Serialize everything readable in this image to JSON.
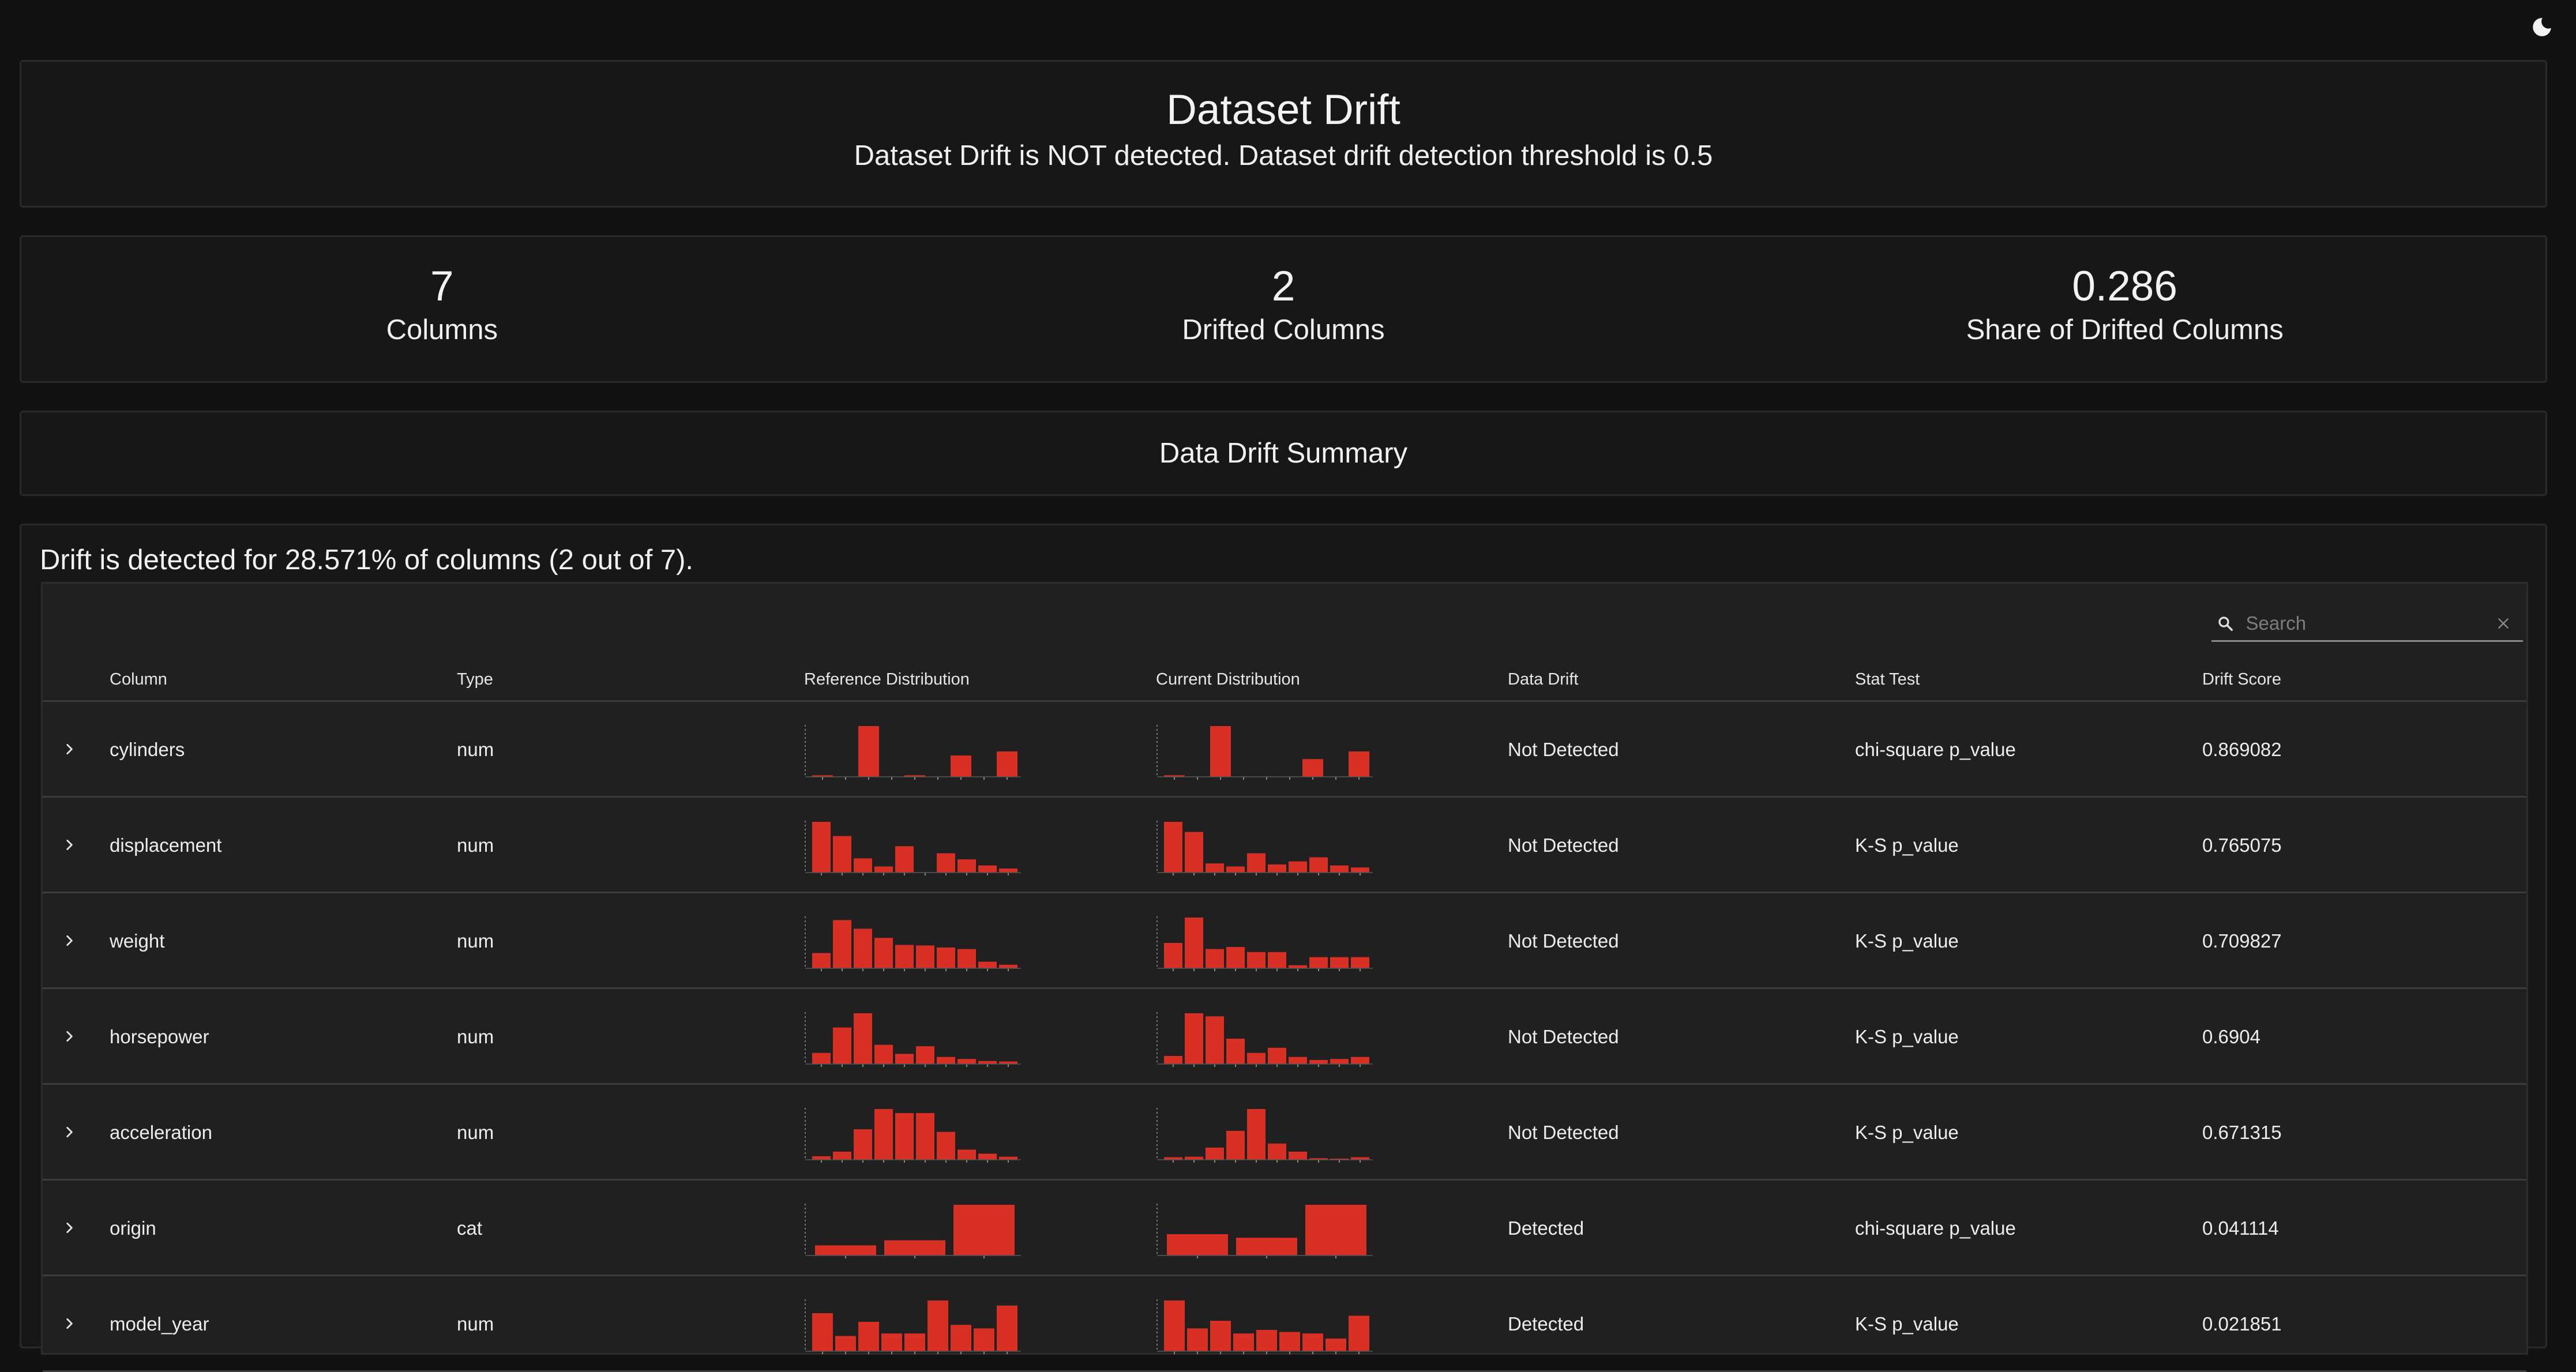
{
  "header": {
    "title": "Dataset Drift",
    "subtitle": "Dataset Drift is NOT detected. Dataset drift detection threshold is 0.5"
  },
  "counters": [
    {
      "value": "7",
      "label": "Columns"
    },
    {
      "value": "2",
      "label": "Drifted Columns"
    },
    {
      "value": "0.286",
      "label": "Share of Drifted Columns"
    }
  ],
  "summary_title": "Data Drift Summary",
  "drift_text": "Drift is detected for 28.571% of columns (2 out of 7).",
  "search": {
    "placeholder": "Search"
  },
  "table": {
    "headers": [
      "Column",
      "Type",
      "Reference Distribution",
      "Current Distribution",
      "Data Drift",
      "Stat Test",
      "Drift Score"
    ],
    "rows": [
      {
        "column": "cylinders",
        "type": "num",
        "drift": "Not Detected",
        "test": "chi-square p_value",
        "score": "0.869082",
        "ref": [
          0.03,
          0,
          1.0,
          0,
          0.03,
          0,
          0.42,
          0,
          0.5
        ],
        "cur": [
          0.03,
          0,
          1.0,
          0,
          0,
          0,
          0.35,
          0,
          0.5
        ]
      },
      {
        "column": "displacement",
        "type": "num",
        "drift": "Not Detected",
        "test": "K-S p_value",
        "score": "0.765075",
        "ref": [
          1.0,
          0.72,
          0.28,
          0.12,
          0.52,
          0,
          0.38,
          0.26,
          0.14,
          0.08
        ],
        "cur": [
          1.0,
          0.8,
          0.18,
          0.12,
          0.38,
          0.16,
          0.22,
          0.3,
          0.14,
          0.1
        ]
      },
      {
        "column": "weight",
        "type": "num",
        "drift": "Not Detected",
        "test": "K-S p_value",
        "score": "0.709827",
        "ref": [
          0.3,
          0.95,
          0.78,
          0.6,
          0.46,
          0.45,
          0.41,
          0.38,
          0.13,
          0.07
        ],
        "cur": [
          0.5,
          1.0,
          0.38,
          0.42,
          0.32,
          0.32,
          0.06,
          0.22,
          0.22,
          0.22
        ]
      },
      {
        "column": "horsepower",
        "type": "num",
        "drift": "Not Detected",
        "test": "K-S p_value",
        "score": "0.6904",
        "ref": [
          0.22,
          0.72,
          1.0,
          0.38,
          0.2,
          0.35,
          0.14,
          0.1,
          0.06,
          0.05
        ],
        "cur": [
          0.16,
          1.0,
          0.94,
          0.5,
          0.22,
          0.32,
          0.14,
          0.08,
          0.1,
          0.14
        ]
      },
      {
        "column": "acceleration",
        "type": "num",
        "drift": "Not Detected",
        "test": "K-S p_value",
        "score": "0.671315",
        "ref": [
          0.07,
          0.16,
          0.6,
          1.0,
          0.92,
          0.92,
          0.55,
          0.2,
          0.12,
          0.06
        ],
        "cur": [
          0.05,
          0.06,
          0.24,
          0.57,
          1.0,
          0.32,
          0.16,
          0.03,
          0.02,
          0.05
        ]
      },
      {
        "column": "origin",
        "type": "cat",
        "drift": "Detected",
        "test": "chi-square p_value",
        "score": "0.041114",
        "ref": [
          0.2,
          0.3,
          1.0
        ],
        "cur": [
          0.42,
          0.35,
          1.0
        ]
      },
      {
        "column": "model_year",
        "type": "num",
        "drift": "Detected",
        "test": "K-S p_value",
        "score": "0.021851",
        "ref": [
          0.75,
          0.3,
          0.58,
          0.35,
          0.35,
          1.0,
          0.52,
          0.45,
          0.9
        ],
        "cur": [
          1.0,
          0.45,
          0.6,
          0.35,
          0.42,
          0.38,
          0.35,
          0.25,
          0.7
        ]
      }
    ]
  },
  "colors": {
    "accent": "#d93025",
    "background": "#121212",
    "panel": "#171717",
    "table": "#202020"
  },
  "icons": {
    "theme": "moon-icon",
    "search": "search-icon",
    "clear": "close-icon",
    "expand": "chevron-right-icon"
  }
}
